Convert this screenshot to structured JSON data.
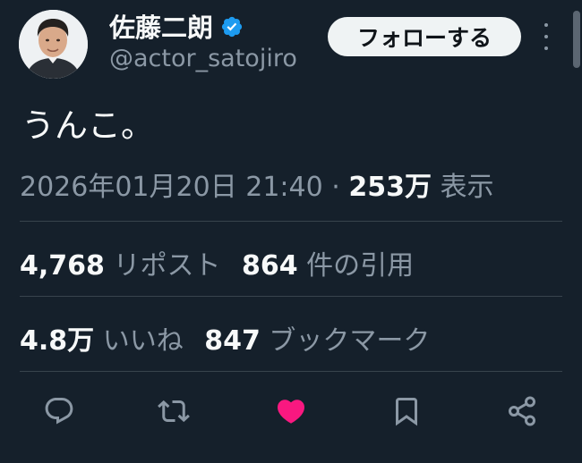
{
  "author": {
    "display_name": "佐藤二朗",
    "handle": "@actor_satojiro",
    "verified": true
  },
  "follow_button_label": "フォローする",
  "tweet": {
    "text": "うんこ。",
    "timestamp": "2026年01月20日 21:40",
    "separator": "·",
    "views_count": "253万",
    "views_label": "表示"
  },
  "stats": {
    "reposts_count": "4,768",
    "reposts_label": "リポスト",
    "quotes_count": "864",
    "quotes_label": "件の引用",
    "likes_count": "4.8万",
    "likes_label": "いいね",
    "bookmarks_count": "847",
    "bookmarks_label": "ブックマーク"
  },
  "actions": {
    "icons": [
      "reply-icon",
      "retweet-icon",
      "like-icon",
      "bookmark-icon",
      "share-icon"
    ],
    "liked": true
  },
  "colors": {
    "background": "#15202b",
    "text_primary": "#f7f9f9",
    "text_secondary": "#8b98a5",
    "divider": "#38444d",
    "verified": "#1d9bf0",
    "like_active": "#f91880",
    "follow_button_bg": "#eff3f4"
  }
}
